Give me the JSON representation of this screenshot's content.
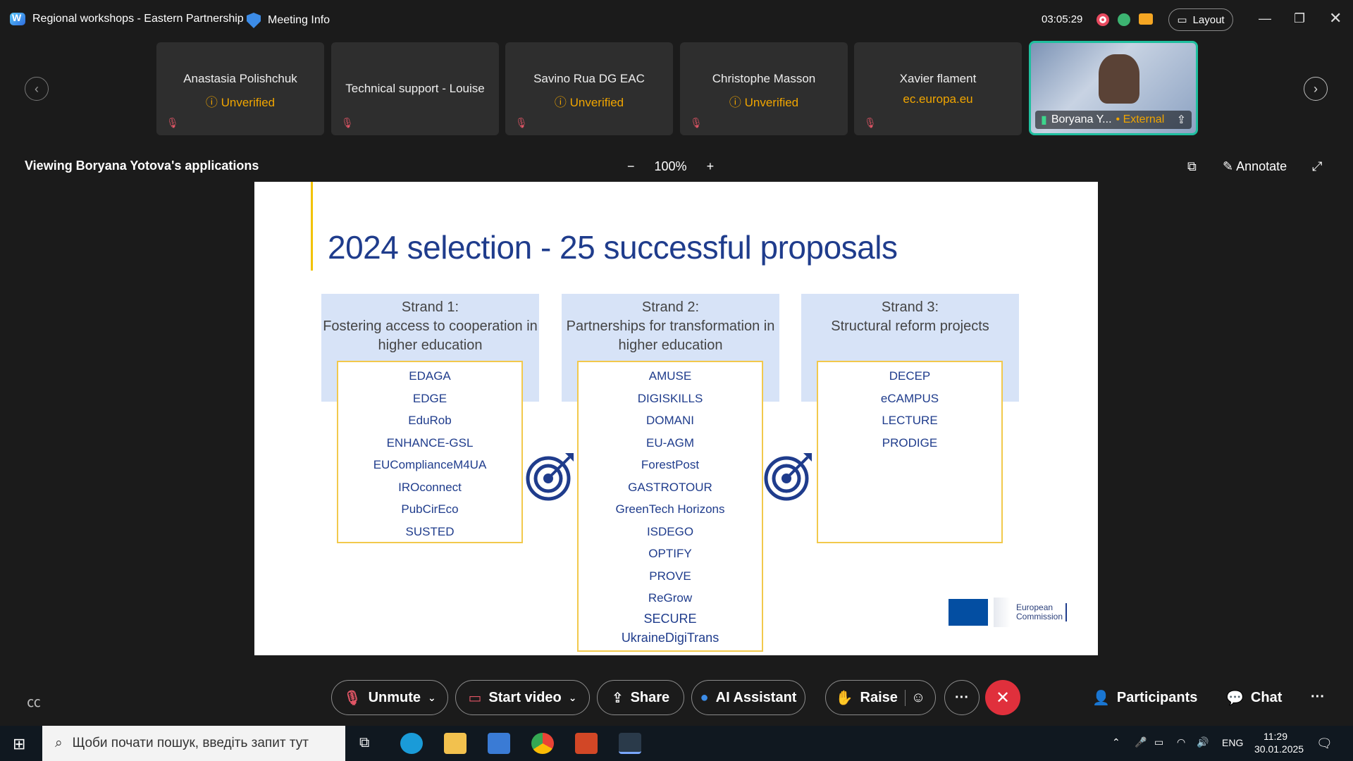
{
  "window": {
    "app_title": "Regional workshops - Eastern Partnership",
    "meeting_info": "Meeting Info",
    "timer": "03:05:29",
    "layout_label": "Layout"
  },
  "participants": [
    {
      "name": "Anastasia Polishchuk",
      "status": "Unverified"
    },
    {
      "name": "Technical support - Louise",
      "status": ""
    },
    {
      "name": "Savino Rua DG EAC",
      "status": "Unverified"
    },
    {
      "name": "Christophe Masson",
      "status": "Unverified"
    },
    {
      "name": "Xavier flament",
      "status": "ec.europa.eu"
    }
  ],
  "video_tile": {
    "name": "Boryana Y...",
    "tag": "External"
  },
  "viewing": {
    "label": "Viewing Boryana Yotova's applications",
    "zoom": "100%",
    "annotate": "Annotate"
  },
  "slide": {
    "title": "2024 selection - 25 successful proposals",
    "strands": [
      {
        "h1": "Strand 1:",
        "h2": "Fostering access to cooperation in",
        "h3": "higher education",
        "items": [
          "EDAGA",
          "EDGE",
          "EduRob",
          "ENHANCE-GSL",
          "EUComplianceM4UA",
          "IROconnect",
          "PubCirEco",
          "SUSTED"
        ]
      },
      {
        "h1": "Strand 2:",
        "h2": "Partnerships for transformation in",
        "h3": "higher education",
        "items": [
          "AMUSE",
          "DIGISKILLS",
          "DOMANI",
          "EU-AGM",
          "ForestPost",
          "GASTROTOUR",
          "GreenTech Horizons",
          "ISDEGO",
          "OPTIFY",
          "PROVE",
          "ReGrow",
          "SECURE",
          "UkraineDigiTrans"
        ]
      },
      {
        "h1": "Strand 3:",
        "h2": "Structural reform projects",
        "h3": "",
        "items": [
          "DECEP",
          "eCAMPUS",
          "LECTURE",
          "PRODIGE"
        ]
      }
    ],
    "ec_line1": "European",
    "ec_line2": "Commission"
  },
  "controls": {
    "unmute": "Unmute",
    "start_video": "Start video",
    "share": "Share",
    "ai": "AI Assistant",
    "raise": "Raise",
    "participants": "Participants",
    "chat": "Chat"
  },
  "taskbar": {
    "search_placeholder": "Щоби почати пошук, введіть запит тут",
    "lang": "ENG",
    "time": "11:29",
    "date": "30.01.2025"
  }
}
